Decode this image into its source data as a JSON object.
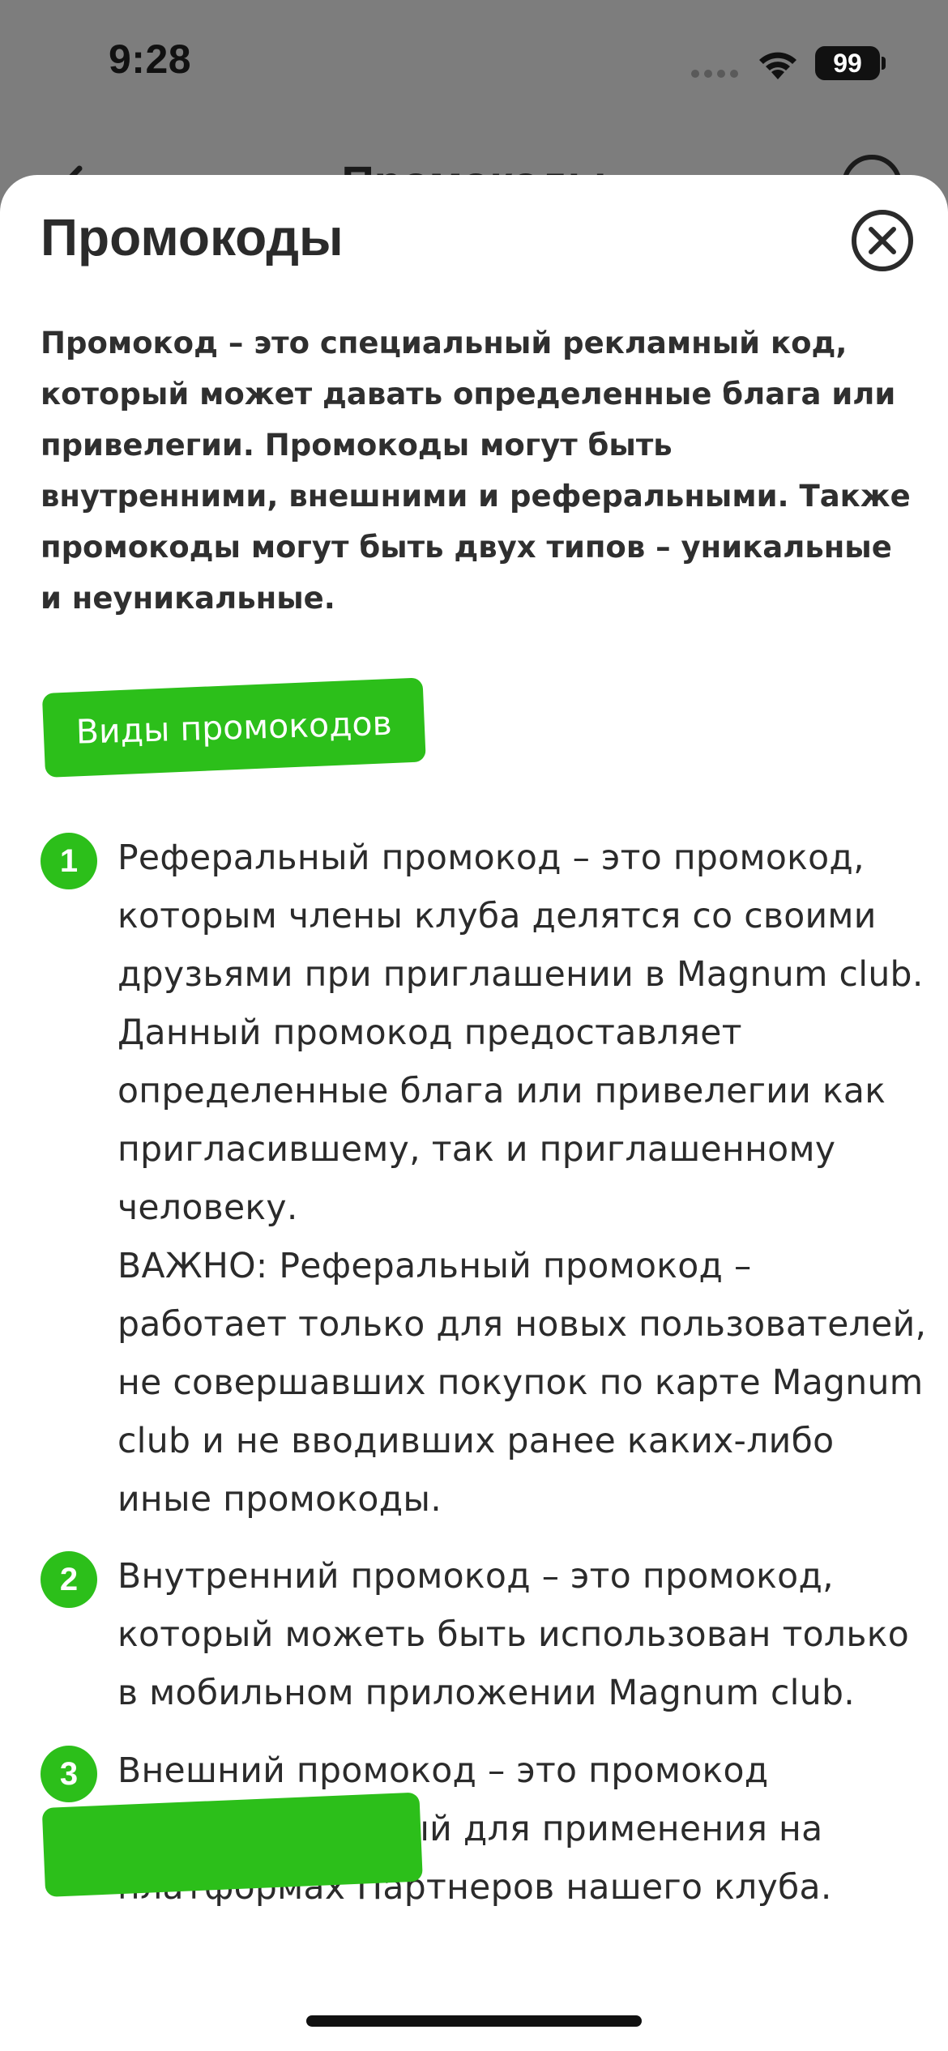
{
  "status_bar": {
    "time": "9:28",
    "battery": "99"
  },
  "under_nav": {
    "title": "Промокоды"
  },
  "sheet": {
    "title": "Промокоды",
    "intro": "Промокод – это специальный рекламный код, который может давать определенные блага или привелегии. Промокоды могут быть внутренними, внешними и реферальными. Также промокоды могут быть двух типов – уникальные и неуникальные.",
    "section_tag": "Виды промокодов",
    "items": [
      {
        "number": "1",
        "text": "Реферальный промокод – это промокод, которым члены клуба делятся со своими друзьями при приглашении в Magnum club. Данный промокод предоставляет определенные блага или привелегии как пригласившему, так и приглашенному человеку.",
        "note": "ВАЖНО: Реферальный промокод – работает только для новых пользователей, не совершавших покупок по карте Magnum club и не вводивших ранее каких-либо иные промокоды."
      },
      {
        "number": "2",
        "text": "Внутренний промокод – это промокод, который можеть быть использован только в мобильном приложении Magnum club."
      },
      {
        "number": "3",
        "text": "Внешний промокод – это промокод предназначенный для применения на платформах Партнеров нашего клуба."
      }
    ]
  },
  "colors": {
    "accent": "#2cbf1a",
    "text": "#2b2b2b",
    "overlay": "#7d7d7d"
  }
}
